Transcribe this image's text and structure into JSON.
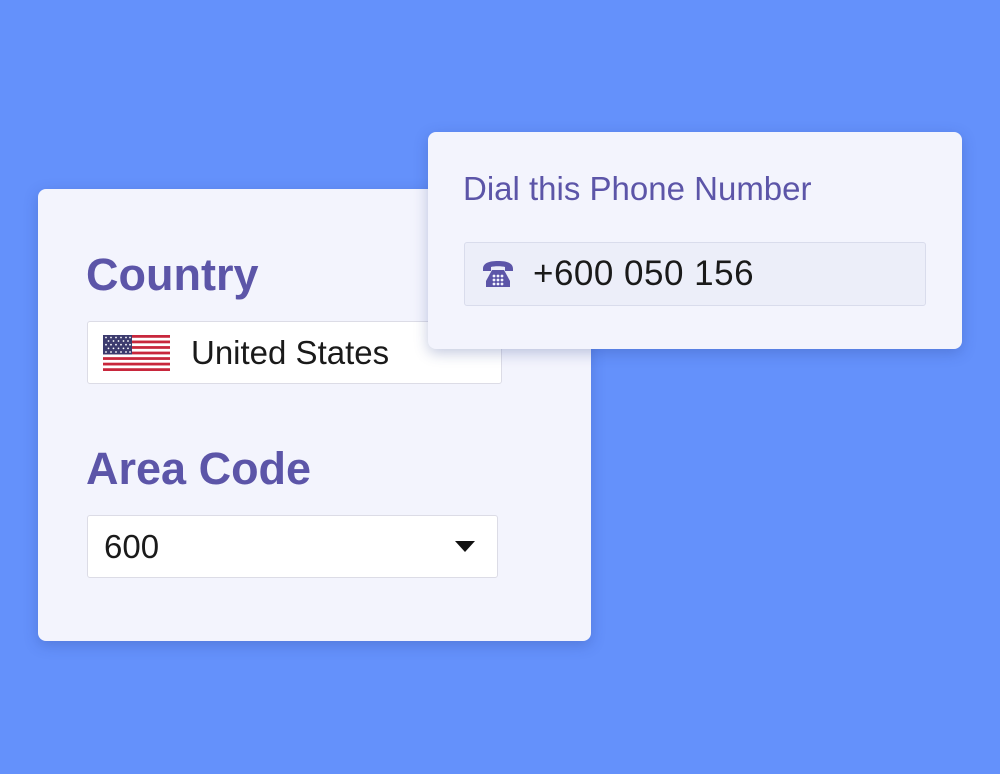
{
  "location_form": {
    "country_label": "Country",
    "country_value": "United States",
    "country_flag_icon": "us-flag-icon",
    "area_code_label": "Area Code",
    "area_code_value": "600",
    "area_code_dropdown_icon": "caret-down-icon"
  },
  "dial_card": {
    "title": "Dial this Phone Number",
    "phone_icon": "telephone-icon",
    "phone_number": "+600 050 156"
  },
  "colors": {
    "background": "#6491fb",
    "card": "#f3f4fd",
    "accent_text": "#5c55a8",
    "field": "#ffffff",
    "phone_field": "#eceef9"
  }
}
